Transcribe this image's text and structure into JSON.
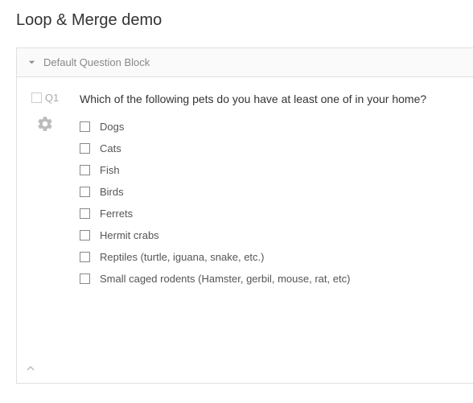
{
  "page": {
    "title": "Loop & Merge demo"
  },
  "block": {
    "title": "Default Question Block"
  },
  "question": {
    "id": "Q1",
    "text": "Which of the following pets do you have at least one of in your home?",
    "choices": [
      "Dogs",
      "Cats",
      "Fish",
      "Birds",
      "Ferrets",
      "Hermit crabs",
      "Reptiles (turtle, iguana, snake, etc.)",
      "Small caged rodents (Hamster, gerbil, mouse, rat, etc)"
    ]
  }
}
